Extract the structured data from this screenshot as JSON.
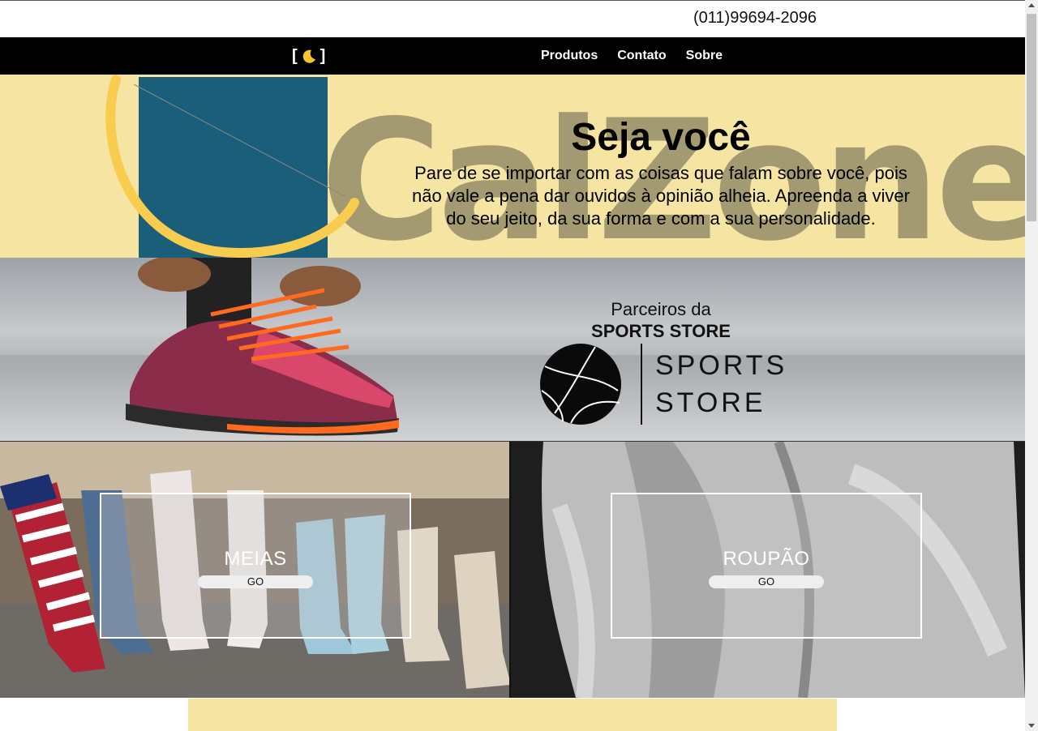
{
  "header": {
    "phone": "(011)99694-2096"
  },
  "nav": {
    "theme_toggle_open": "[",
    "theme_toggle_close": "]",
    "links": [
      {
        "label": "Produtos"
      },
      {
        "label": "Contato"
      },
      {
        "label": "Sobre"
      }
    ]
  },
  "hero": {
    "logo_text": "CalZone",
    "title": "Seja você",
    "body": "Pare de se importar com as coisas que falam sobre você, pois não vale a pena dar ouvidos à opinião alheia. Apreenda a viver do seu jeito, da sua forma e com a sua personalidade.",
    "colors": {
      "background": "#f6e5a2",
      "blue": "#1b5e79",
      "arc": "#f8cc4e"
    }
  },
  "partners": {
    "pre": "Parceiros da",
    "name": "SPORTS STORE",
    "logo_line1": "SPORTS",
    "logo_line2": "STORE",
    "icons": {
      "ball": "basketball-icon"
    }
  },
  "categories": [
    {
      "label": "MEIAS",
      "button": "GO"
    },
    {
      "label": "ROUPÃO",
      "button": "GO"
    }
  ],
  "scrollbar": {
    "thumb_fraction": 0.28
  }
}
